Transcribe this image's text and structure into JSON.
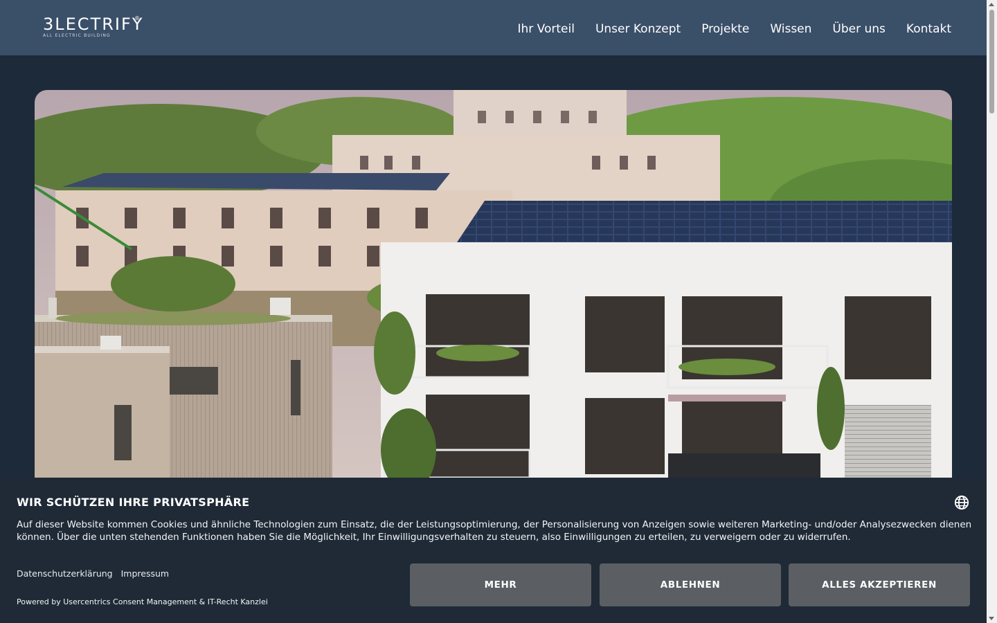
{
  "header": {
    "logo": {
      "text": "3LECTRIFY",
      "registered": "®",
      "tagline": "ALL ELECTRIC BUILDING"
    },
    "nav": [
      "Ihr Vorteil",
      "Unser Konzept",
      "Projekte",
      "Wissen",
      "Über uns",
      "Kontakt"
    ]
  },
  "hero": {
    "image": "apartment-buildings-with-rooftop-solar-panels"
  },
  "consent": {
    "title": "WIR SCHÜTZEN IHRE PRIVATSPHÄRE",
    "text": "Auf dieser Website kommen Cookies und ähnliche Technologien zum Einsatz, die der Leistungsoptimierung, der Personalisierung von Anzeigen sowie weiteren Marketing- und/oder Analysezwecken dienen können. Über die unten stehenden Funktionen haben Sie die Möglichkeit, Ihr Einwilligungsverhalten zu steuern, also Einwilligungen zu erteilen, zu verweigern oder zu widerrufen.",
    "links": {
      "privacy": "Datenschutzerklärung",
      "imprint": "Impressum"
    },
    "powered_by": "Powered by Usercentrics Consent Management & IT-Recht Kanzlei",
    "buttons": {
      "more": "MEHR",
      "deny": "ABLEHNEN",
      "accept": "ALLES AKZEPTIEREN"
    },
    "language_icon": "globe-icon"
  },
  "colors": {
    "header_bg": "#3a4f68",
    "page_bg": "#1d2a3a",
    "banner_bg": "#1f2a36",
    "button_bg": "#5b5f63"
  }
}
